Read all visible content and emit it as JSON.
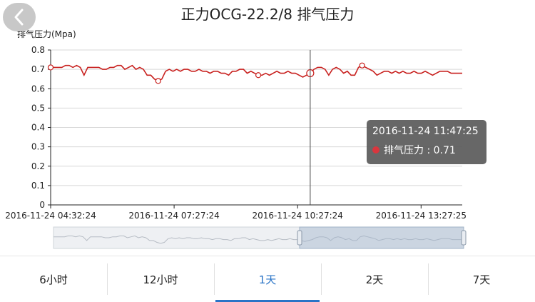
{
  "header": {
    "title": "正力OCG-22.2/8  排气压力",
    "back_icon": "chevron-left-icon"
  },
  "colors": {
    "series": "#c8201e",
    "accent": "#2a74c7",
    "axis": "#222222",
    "grid": "#d8d8d8"
  },
  "chart_data": {
    "type": "line",
    "ylabel": "排气压力(Mpa)",
    "ylim": [
      0,
      0.8
    ],
    "yticks": [
      "0",
      "0.1",
      "0.2",
      "0.3",
      "0.4",
      "0.5",
      "0.6",
      "0.7",
      "0.8"
    ],
    "x_start": "2016-11-24 04:32:24",
    "x_end": "2016-11-24 14:32:24",
    "xtick_labels": [
      "2016-11-24 04:32:24",
      "2016-11-24 07:27:24",
      "2016-11-24 10:27:24",
      "2016-11-24 13:27:25"
    ],
    "series": [
      {
        "values": [
          0.71,
          0.71,
          0.71,
          0.71,
          0.72,
          0.72,
          0.71,
          0.72,
          0.71,
          0.67,
          0.71,
          0.71,
          0.71,
          0.71,
          0.7,
          0.7,
          0.71,
          0.71,
          0.72,
          0.72,
          0.7,
          0.71,
          0.72,
          0.7,
          0.71,
          0.7,
          0.67,
          0.67,
          0.65,
          0.64,
          0.65,
          0.69,
          0.7,
          0.69,
          0.7,
          0.69,
          0.7,
          0.7,
          0.69,
          0.69,
          0.7,
          0.69,
          0.69,
          0.68,
          0.69,
          0.69,
          0.68,
          0.68,
          0.67,
          0.69,
          0.69,
          0.7,
          0.7,
          0.68,
          0.69,
          0.68,
          0.67,
          0.67,
          0.68,
          0.67,
          0.68,
          0.69,
          0.68,
          0.68,
          0.69,
          0.68,
          0.68,
          0.67,
          0.66,
          0.67,
          0.68,
          0.7,
          0.71,
          0.71,
          0.7,
          0.67,
          0.7,
          0.71,
          0.7,
          0.68,
          0.69,
          0.67,
          0.67,
          0.71,
          0.72,
          0.71,
          0.7,
          0.69,
          0.67,
          0.68,
          0.69,
          0.69,
          0.68,
          0.69,
          0.68,
          0.69,
          0.68,
          0.68,
          0.69,
          0.68,
          0.68,
          0.69,
          0.68,
          0.67,
          0.68,
          0.69,
          0.69,
          0.69,
          0.68,
          0.68,
          0.68,
          0.68
        ],
        "markers": [
          0,
          29,
          56,
          70,
          84
        ]
      }
    ],
    "grid": true,
    "tooltip": {
      "time": "2016-11-24 11:47:25",
      "label": "排气压力 : 0.71",
      "index": 70
    }
  },
  "tabs": [
    {
      "label": "6小时",
      "active": false
    },
    {
      "label": "12小时",
      "active": false
    },
    {
      "label": "1天",
      "active": true
    },
    {
      "label": "2天",
      "active": false
    },
    {
      "label": "7天",
      "active": false
    }
  ]
}
